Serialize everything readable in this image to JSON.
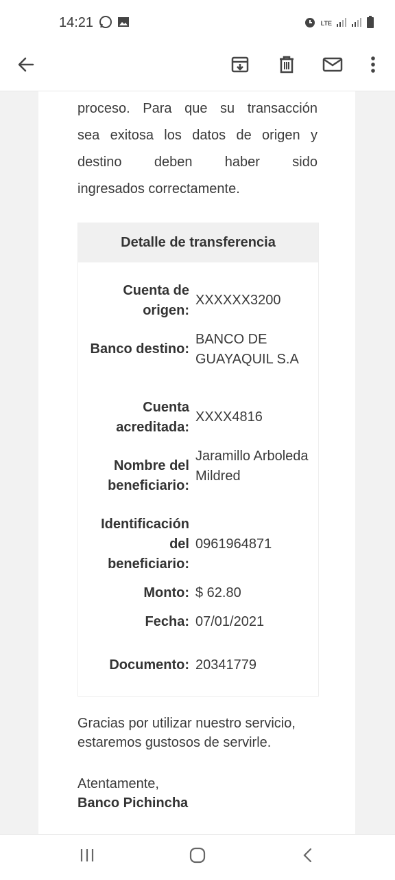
{
  "status_bar": {
    "time": "14:21",
    "network_label": "LTE",
    "icons": [
      "whatsapp-icon",
      "image-icon",
      "alarm-icon",
      "lte-icon",
      "signal-icon",
      "signal-icon",
      "battery-icon"
    ]
  },
  "app_bar": {
    "back_icon": "arrow-left-icon",
    "archive_icon": "archive-icon",
    "delete_icon": "trash-icon",
    "mark_unread_icon": "mail-icon",
    "more_icon": "more-vertical-icon"
  },
  "email": {
    "intro_lines": [
      "proceso. Para que su transacción",
      "sea exitosa los datos de origen y",
      "destino deben haber sido",
      "ingresados correctamente."
    ],
    "detail": {
      "title": "Detalle de transferencia",
      "rows": [
        {
          "label": "Cuenta de origen:",
          "value": "XXXXXX3200"
        },
        {
          "label": "Banco destino:",
          "value": "BANCO DE GUAYAQUIL S.A"
        },
        {
          "label": "Cuenta acreditada:",
          "value": "XXXX4816"
        },
        {
          "label": "Nombre del beneficiario:",
          "value": "Jaramillo Arboleda Mildred"
        },
        {
          "label": "Identificación del beneficiario:",
          "value": "0961964871"
        },
        {
          "label": "Monto:",
          "value": "$ 62.80"
        },
        {
          "label": "Fecha:",
          "value": "07/01/2021"
        },
        {
          "label": "Documento:",
          "value": "20341779"
        }
      ]
    },
    "closing": "Gracias por utilizar nuestro servicio, estaremos gustosos de servirle.",
    "signoff": "Atentamente,",
    "bank_name": "Banco Pichincha"
  },
  "nav_bar": {
    "recents_icon": "recents-icon",
    "home_icon": "home-icon",
    "back_icon": "back-chevron-icon"
  },
  "colors": {
    "text": "#3a3a3a",
    "header_bg": "#f0f0f0",
    "side_bg": "#f2f2f2"
  }
}
